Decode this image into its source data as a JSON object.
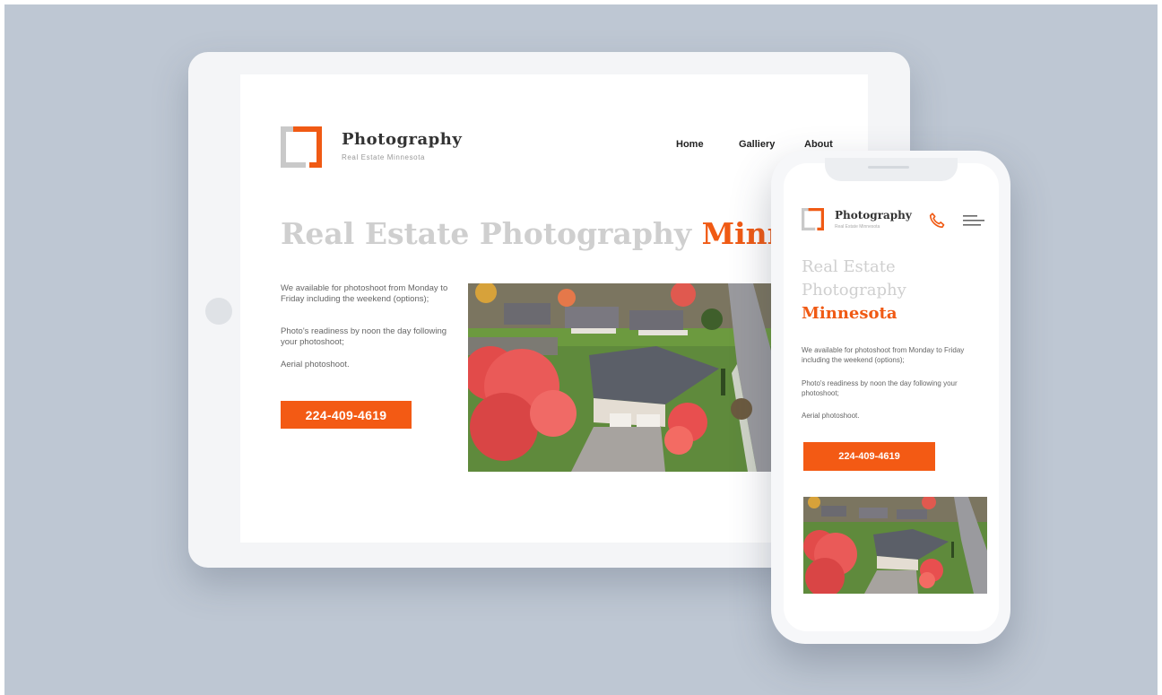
{
  "brand": {
    "name": "Photography",
    "tagline": "Real Estate Minnesota",
    "accent_color": "#f05a14",
    "muted_color": "#cfcfcf"
  },
  "nav": {
    "items": [
      "Home",
      "Galliery",
      "About"
    ]
  },
  "hero": {
    "headline_part1": "Real Estate Photography ",
    "headline_accent": "Minnesota",
    "mobile_line1": "Real Estate",
    "mobile_line2": "Photography",
    "mobile_line3": "Minnesota"
  },
  "content": {
    "desktop": {
      "para1": "We available for photoshoot from Monday to Friday including the weekend (options);",
      "para2": "Photo's readiness by noon the day following your photoshoot;",
      "para3": "Aerial photoshoot."
    },
    "mobile": {
      "para1": "We available for photoshoot from Monday to Friday including the weekend (options);",
      "para2": "Photo's readiness by noon the day following your photoshoot;",
      "para3": "Aerial photoshoot."
    }
  },
  "cta": {
    "phone": "224-409-4619"
  },
  "icons": {
    "logo": "logo-icon",
    "phone": "phone-icon",
    "menu": "hamburger-menu-icon",
    "photo": "aerial-house-photo"
  }
}
